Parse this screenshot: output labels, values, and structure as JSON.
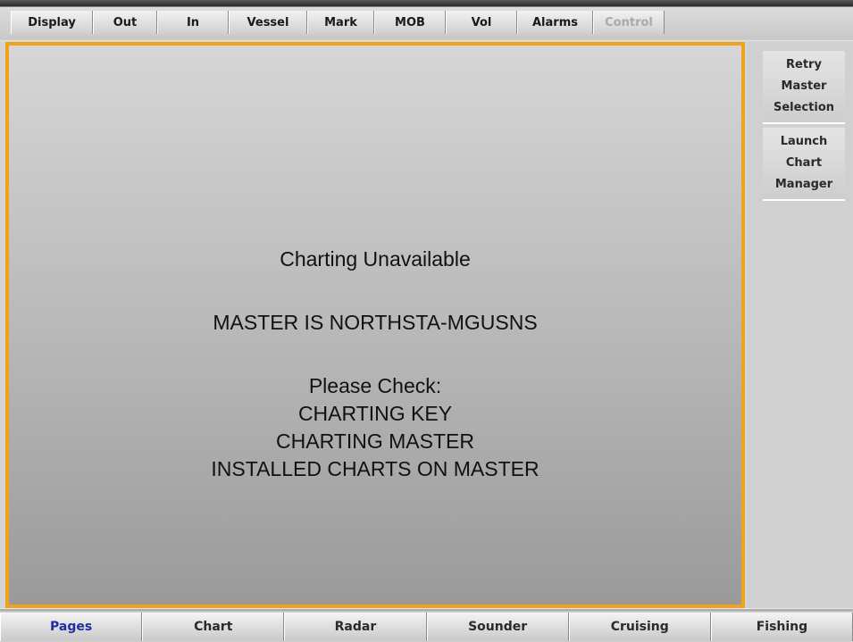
{
  "top_menu": {
    "items": [
      {
        "label": "Display",
        "enabled": true
      },
      {
        "label": "Out",
        "enabled": true
      },
      {
        "label": "In",
        "enabled": true
      },
      {
        "label": "Vessel",
        "enabled": true
      },
      {
        "label": "Mark",
        "enabled": true
      },
      {
        "label": "MOB",
        "enabled": true
      },
      {
        "label": "Vol",
        "enabled": true
      },
      {
        "label": "Alarms",
        "enabled": true
      },
      {
        "label": "Control",
        "enabled": false
      }
    ]
  },
  "main": {
    "title": "Charting Unavailable",
    "master_line": "MASTER IS NORTHSTA-MGUSNS",
    "check_heading": "Please Check:",
    "check_items": [
      "CHARTING KEY",
      "CHARTING MASTER",
      "INSTALLED CHARTS ON MASTER"
    ]
  },
  "side_panel": {
    "retry_button": "Retry\nMaster\nSelection",
    "launch_button": "Launch\nChart\nManager"
  },
  "bottom_tabs": {
    "tabs": [
      {
        "label": "Pages",
        "active": true
      },
      {
        "label": "Chart",
        "active": false
      },
      {
        "label": "Radar",
        "active": false
      },
      {
        "label": "Sounder",
        "active": false
      },
      {
        "label": "Cruising",
        "active": false
      },
      {
        "label": "Fishing",
        "active": false
      }
    ]
  },
  "colors": {
    "frame_border": "#f0a21b",
    "active_tab_text": "#1f2fa0",
    "disabled_text": "#a9a9a9"
  }
}
